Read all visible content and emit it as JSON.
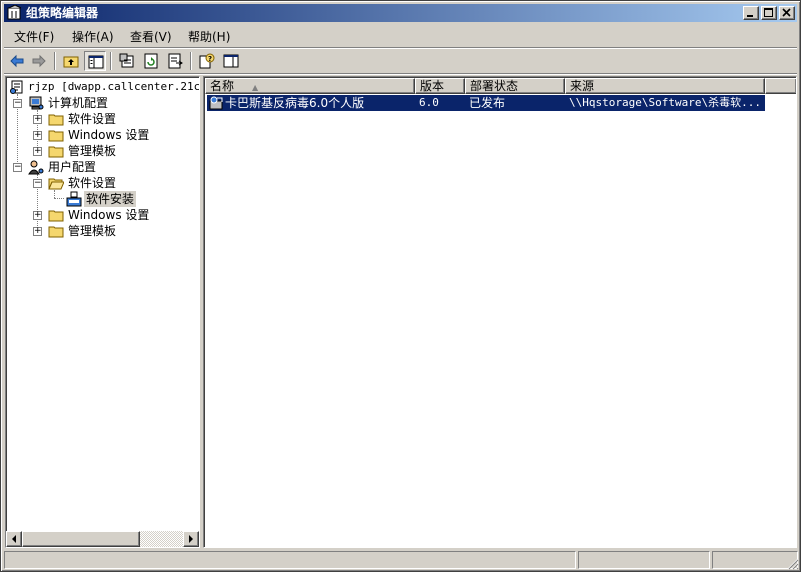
{
  "window": {
    "title": "组策略编辑器"
  },
  "menu": {
    "items": [
      "文件(F)",
      "操作(A)",
      "查看(V)",
      "帮助(H)"
    ]
  },
  "tree": {
    "root": "rjzp [dwapp.callcenter.21cn.",
    "computer_config": "计算机配置",
    "comp_software": "软件设置",
    "comp_windows": "Windows 设置",
    "comp_templates": "管理模板",
    "user_config": "用户配置",
    "user_software": "软件设置",
    "user_software_install": "软件安装",
    "user_windows": "Windows 设置",
    "user_templates": "管理模板"
  },
  "list": {
    "columns": [
      "名称",
      "版本",
      "部署状态",
      "来源"
    ],
    "rows": [
      {
        "name": "卡巴斯基反病毒6.0个人版",
        "version": "6.0",
        "status": "已发布",
        "source": "\\\\Hqstorage\\Software\\杀毒软..."
      }
    ]
  },
  "colors": {
    "title_start": "#0a246a",
    "title_end": "#a6caf0",
    "selection": "#0a246a",
    "face": "#d4d0c8"
  }
}
